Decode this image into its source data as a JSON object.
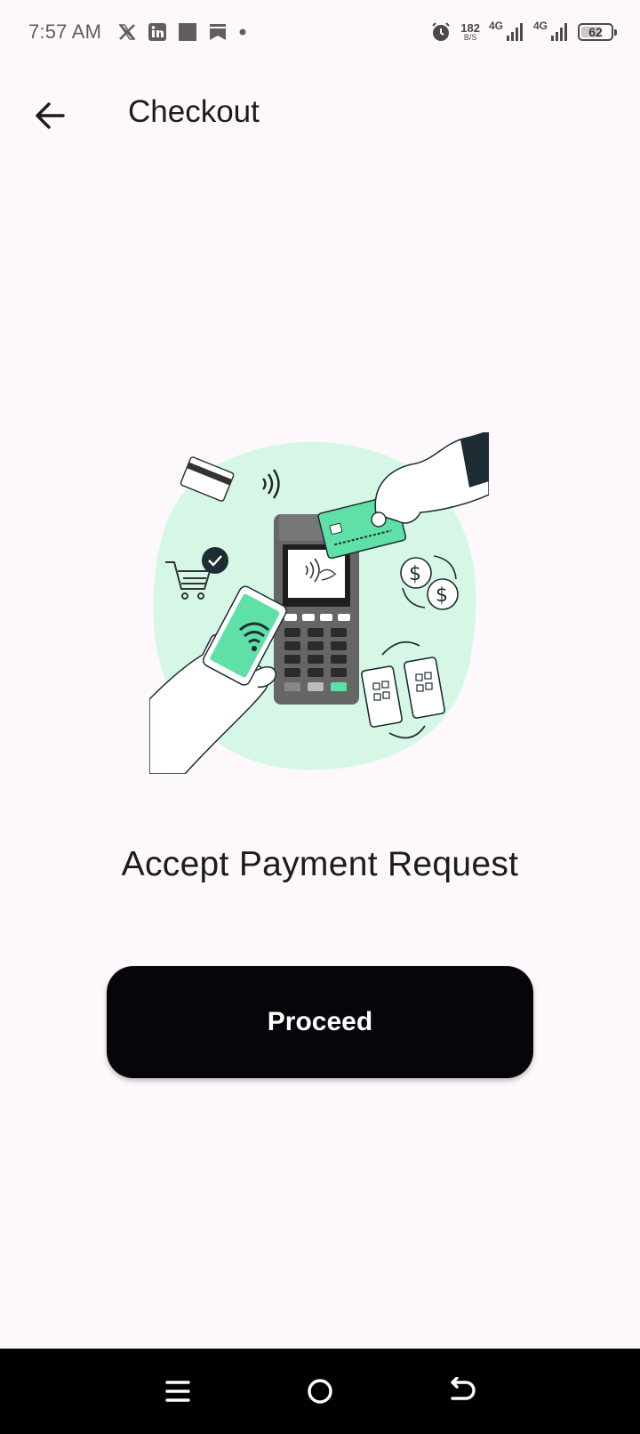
{
  "status_bar": {
    "time": "7:57 AM",
    "notification_icons": [
      "x-icon",
      "linkedin-icon",
      "square-icon",
      "bookmark-icon",
      "dot-icon"
    ],
    "alarm_icon": "alarm-icon",
    "net_speed_value": "182",
    "net_speed_unit": "B/S",
    "network_1": "4G",
    "network_2": "4G",
    "battery_level": "62"
  },
  "app_bar": {
    "back_icon": "arrow-left-icon",
    "title": "Checkout"
  },
  "main": {
    "illustration_icon": "contactless-payment-illustration",
    "headline": "Accept Payment Request",
    "proceed_label": "Proceed"
  },
  "nav_bar": {
    "items": [
      "menu-icon",
      "home-icon",
      "back-icon"
    ]
  },
  "colors": {
    "background": "#fdf8fb",
    "accent_green": "#5ee0a6",
    "light_green": "#d6f7e6",
    "button_bg": "#060509"
  }
}
